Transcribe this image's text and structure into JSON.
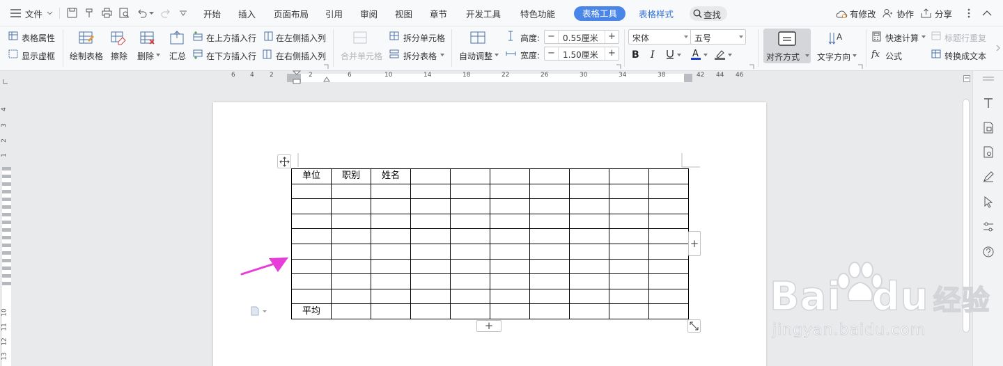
{
  "menubar": {
    "file_label": "文件",
    "tabs": [
      "开始",
      "插入",
      "页面布局",
      "引用",
      "审阅",
      "视图",
      "章节",
      "开发工具",
      "特色功能"
    ],
    "active_tab": "表格工具",
    "table_style_tab": "表格样式",
    "search_label": "查找",
    "modified_label": "有修改",
    "collab_label": "协作",
    "share_label": "分享"
  },
  "ribbon": {
    "table_props": "表格属性",
    "show_gridlines": "显示虚框",
    "draw_table": "绘制表格",
    "erase": "擦除",
    "delete": "删除",
    "summary": "汇总",
    "insert_above": "在上方插入行",
    "insert_below": "在下方插入行",
    "insert_left": "在左侧插入列",
    "insert_right": "在右侧插入列",
    "merge_cells": "合并单元格",
    "split_cells": "拆分单元格",
    "split_table": "拆分表格",
    "auto_fit": "自动调整",
    "height_label": "高度:",
    "height_value": "0.55厘米",
    "width_label": "宽度:",
    "width_value": "1.50厘米",
    "font_name": "宋体",
    "font_size": "五号",
    "align": "对齐方式",
    "text_direction": "文字方向",
    "quick_calc": "快速计算",
    "repeat_header": "标题行重复",
    "formula": "公式",
    "convert_to_text": "转换成文本"
  },
  "ruler": {
    "numbers": [
      "6",
      "4",
      "2",
      "2",
      "6",
      "10",
      "14",
      "18",
      "22",
      "26",
      "30",
      "34",
      "38",
      "42",
      "44",
      "46"
    ],
    "vertical_numbers": [
      "4",
      "3",
      "2",
      "1",
      "10",
      "11",
      "12",
      "13"
    ]
  },
  "table": {
    "columns": 10,
    "header_cells": [
      "单位",
      "职别",
      "姓名"
    ],
    "last_row_label": "平均",
    "rows": 10
  },
  "watermark": {
    "brand": "Bai",
    "brand_suffix": "du",
    "brand_cn": "经验",
    "url": "jingyan.baidu.com"
  },
  "colors": {
    "accent": "#4a86e8",
    "arrow": "#e83ed9"
  }
}
